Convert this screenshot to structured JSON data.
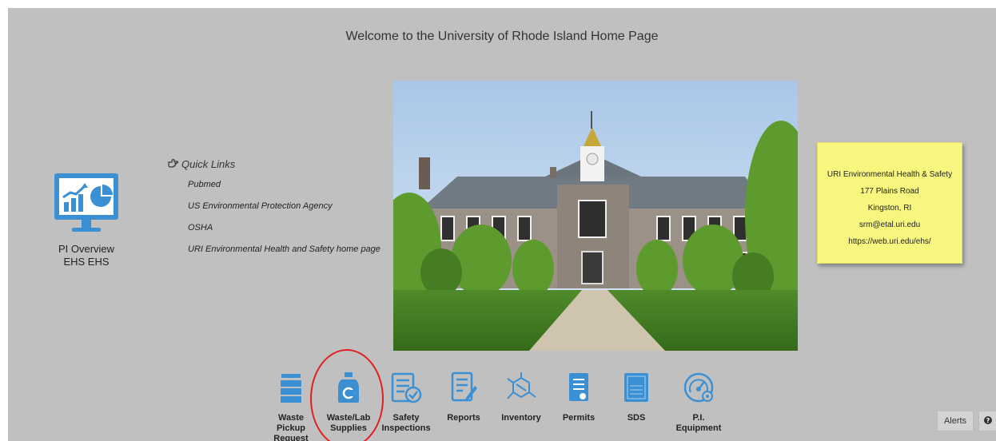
{
  "page": {
    "welcome": "Welcome to the University of Rhode Island Home Page"
  },
  "pi_overview": {
    "line1": "PI Overview",
    "line2": "EHS EHS",
    "icon": "dashboard-monitor-icon"
  },
  "quick_links": {
    "title": "Quick Links",
    "icon": "hand-point-right-icon",
    "items": [
      "Pubmed",
      "US Environmental Protection Agency",
      "OSHA",
      "URI Environmental Health and Safety home page"
    ]
  },
  "contact": {
    "lines": [
      "URI Environmental Health & Safety",
      "177 Plains Road",
      "Kingston, RI",
      "srm@etal.uri.edu",
      "https://web.uri.edu/ehs/"
    ]
  },
  "toolbar": {
    "items": [
      {
        "label": "Waste Pickup Request",
        "icon": "waste-drum-icon"
      },
      {
        "label": "Waste/Lab Supplies",
        "icon": "chemical-jug-icon"
      },
      {
        "label": "Safety Inspections",
        "icon": "checklist-icon"
      },
      {
        "label": "Reports",
        "icon": "report-document-icon"
      },
      {
        "label": "Inventory",
        "icon": "molecule-icon"
      },
      {
        "label": "Permits",
        "icon": "permit-document-icon"
      },
      {
        "label": "SDS",
        "icon": "sds-sheet-icon"
      },
      {
        "label": "P.I. Equipment",
        "icon": "gauge-icon"
      }
    ]
  },
  "footer": {
    "alerts": "Alerts",
    "help_icon": "question-circle-icon"
  },
  "colors": {
    "background": "#c0c0c0",
    "icon_blue": "#3b8fd3",
    "note_yellow": "#f7f77f",
    "highlight_circle": "#e02020"
  }
}
